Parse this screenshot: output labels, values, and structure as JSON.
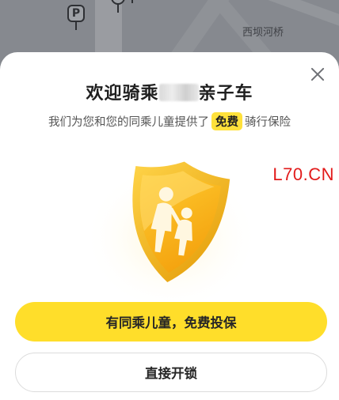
{
  "map": {
    "place_label": "西坝河桥",
    "poi_parking": "P"
  },
  "dialog": {
    "title_prefix": "欢迎骑乘",
    "title_suffix": "亲子车",
    "subtitle_before": "我们为您和您的同乘儿童提供了",
    "subtitle_badge": "免费",
    "subtitle_after": "骑行保险",
    "primary_button": "有同乘儿童，免费投保",
    "secondary_button": "直接开锁"
  },
  "watermark": "L70.CN",
  "colors": {
    "accent_yellow": "#ffde2a",
    "shield_gold": "#f7b51a",
    "watermark_red": "#e21b1b"
  },
  "icons": {
    "close": "close-icon",
    "shield": "child-insurance-shield-icon"
  }
}
